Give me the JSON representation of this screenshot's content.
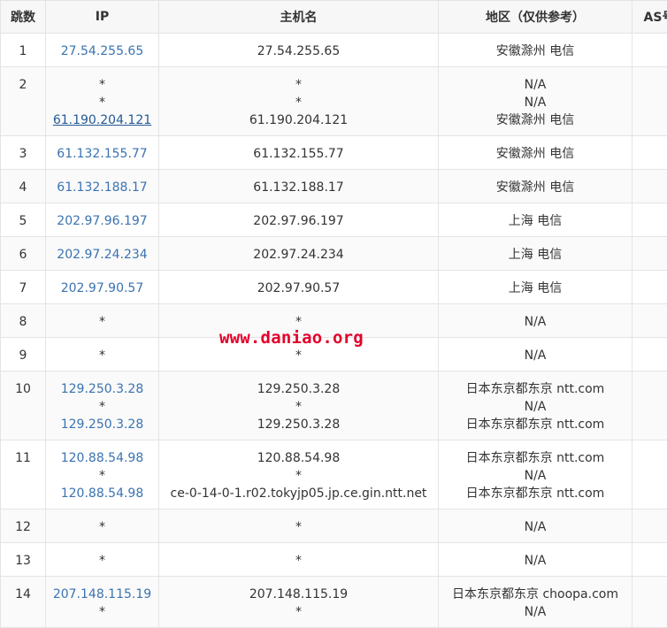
{
  "table": {
    "headers": [
      "跳数",
      "IP",
      "主机名",
      "地区（仅供参考）",
      "AS号"
    ],
    "rows": [
      {
        "hop": "1",
        "ips": [
          "27.54.255.65"
        ],
        "hosts": [
          "27.54.255.65"
        ],
        "regions": [
          "安徽滁州 电信"
        ]
      },
      {
        "hop": "2",
        "ips": [
          "*",
          "*",
          "61.190.204.121"
        ],
        "hosts": [
          "*",
          "*",
          "61.190.204.121"
        ],
        "regions": [
          "N/A",
          "N/A",
          "安徽滁州 电信"
        ]
      },
      {
        "hop": "3",
        "ips": [
          "61.132.155.77"
        ],
        "hosts": [
          "61.132.155.77"
        ],
        "regions": [
          "安徽滁州 电信"
        ]
      },
      {
        "hop": "4",
        "ips": [
          "61.132.188.17"
        ],
        "hosts": [
          "61.132.188.17"
        ],
        "regions": [
          "安徽滁州 电信"
        ]
      },
      {
        "hop": "5",
        "ips": [
          "202.97.96.197"
        ],
        "hosts": [
          "202.97.96.197"
        ],
        "regions": [
          "上海 电信"
        ]
      },
      {
        "hop": "6",
        "ips": [
          "202.97.24.234"
        ],
        "hosts": [
          "202.97.24.234"
        ],
        "regions": [
          "上海 电信"
        ]
      },
      {
        "hop": "7",
        "ips": [
          "202.97.90.57"
        ],
        "hosts": [
          "202.97.90.57"
        ],
        "regions": [
          "上海 电信"
        ]
      },
      {
        "hop": "8",
        "ips": [
          "*"
        ],
        "hosts": [
          "*"
        ],
        "regions": [
          "N/A"
        ]
      },
      {
        "hop": "9",
        "ips": [
          "*"
        ],
        "hosts": [
          "*"
        ],
        "regions": [
          "N/A"
        ]
      },
      {
        "hop": "10",
        "ips": [
          "129.250.3.28",
          "*",
          "129.250.3.28"
        ],
        "hosts": [
          "129.250.3.28",
          "*",
          "129.250.3.28"
        ],
        "regions": [
          "日本东京都东京 ntt.com",
          "N/A",
          "日本东京都东京 ntt.com"
        ]
      },
      {
        "hop": "11",
        "ips": [
          "120.88.54.98",
          "*",
          "120.88.54.98"
        ],
        "hosts": [
          "120.88.54.98",
          "*",
          "ce-0-14-0-1.r02.tokyjp05.jp.ce.gin.ntt.net"
        ],
        "regions": [
          "日本东京都东京 ntt.com",
          "N/A",
          "日本东京都东京 ntt.com"
        ]
      },
      {
        "hop": "12",
        "ips": [
          "*"
        ],
        "hosts": [
          "*"
        ],
        "regions": [
          "N/A"
        ]
      },
      {
        "hop": "13",
        "ips": [
          "*"
        ],
        "hosts": [
          "*"
        ],
        "regions": [
          "N/A"
        ]
      },
      {
        "hop": "14",
        "ips": [
          "207.148.115.19",
          "*"
        ],
        "hosts": [
          "207.148.115.19",
          "*"
        ],
        "regions": [
          "日本东京都东京 choopa.com",
          "N/A"
        ]
      }
    ]
  },
  "watermark": "www.daniao.org",
  "colors": {
    "link": "#3a73b0",
    "header_bg": "#f7f7f7",
    "border": "#e4e4e4",
    "watermark": "#e3002b"
  }
}
